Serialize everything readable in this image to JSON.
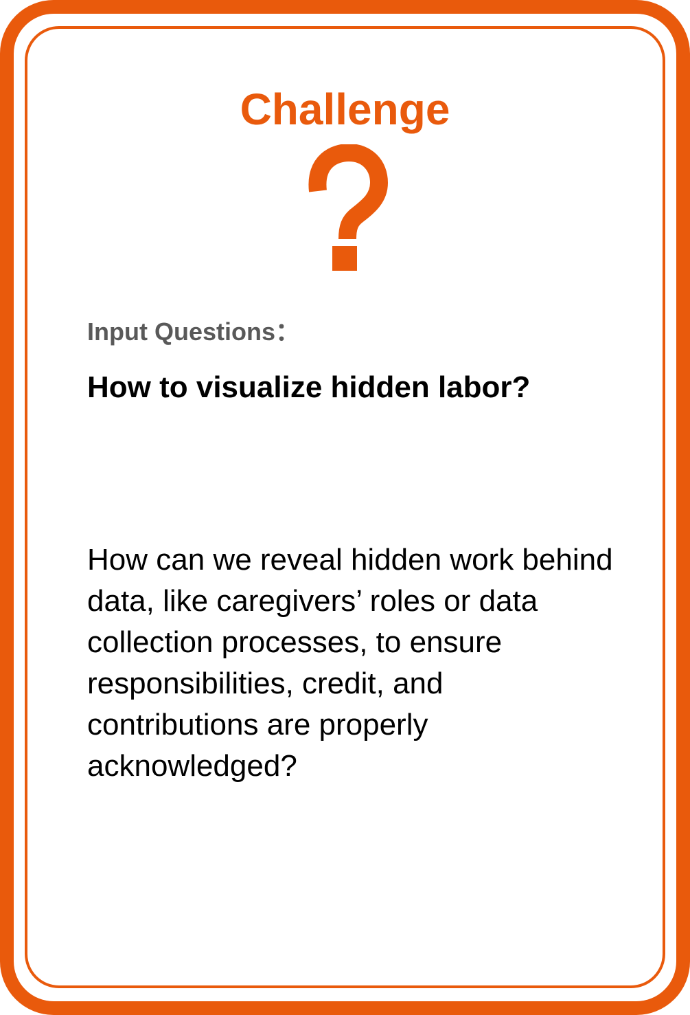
{
  "card": {
    "title": "Challenge",
    "icon": "question-mark-icon",
    "input_label": "Input Questions：",
    "question_title": "How to visualize hidden labor?",
    "description": "How can we reveal hidden work behind data, like caregivers’ roles or data collection processes, to ensure responsibilities, credit, and contributions are properly acknowledged?"
  },
  "colors": {
    "accent": "#E95A0C",
    "label": "#595959",
    "text": "#000000"
  }
}
